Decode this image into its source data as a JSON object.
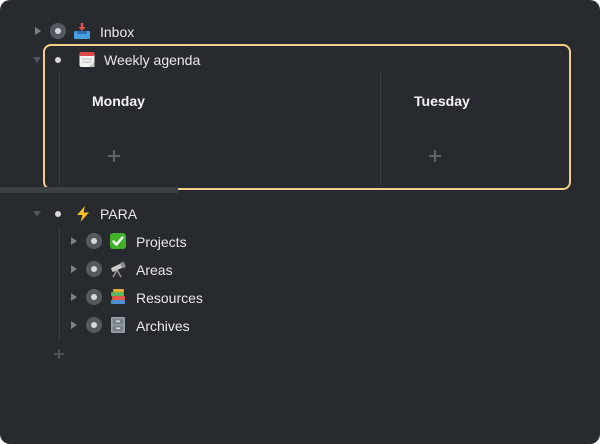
{
  "items": {
    "inbox": {
      "label": "Inbox",
      "icon": "inbox-tray-icon"
    },
    "weekly_agenda": {
      "label": "Weekly agenda",
      "icon": "calendar-icon",
      "columns": [
        {
          "title": "Monday"
        },
        {
          "title": "Tuesday"
        }
      ]
    },
    "para": {
      "label": "PARA",
      "icon": "lightning-icon",
      "children": [
        {
          "label": "Projects",
          "icon": "check-mark-button-icon"
        },
        {
          "label": "Areas",
          "icon": "telescope-icon"
        },
        {
          "label": "Resources",
          "icon": "books-icon"
        },
        {
          "label": "Archives",
          "icon": "file-cabinet-icon"
        }
      ]
    }
  },
  "colors": {
    "background": "#272b2f",
    "highlight_border": "#f3cf86",
    "text": "#e8e9ea"
  }
}
